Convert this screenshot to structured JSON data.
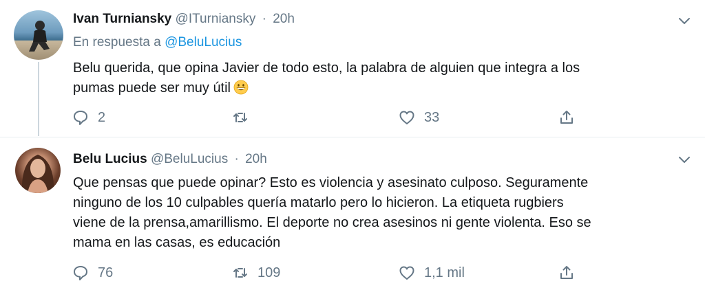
{
  "tweets": [
    {
      "name": "Ivan Turniansky",
      "handle": "@ITurniansky",
      "separator": "·",
      "time": "20h",
      "reply_prefix": "En respuesta a",
      "reply_mention": "@BeluLucius",
      "text": "Belu querida, que opina Javier de todo esto, la palabra de alguien  que integra a los\npumas puede ser muy útil",
      "emoji": "grinning-face-emoji",
      "replies": "2",
      "retweets": "",
      "likes": "33"
    },
    {
      "name": "Belu Lucius",
      "handle": "@BeluLucius",
      "separator": "·",
      "time": "20h",
      "text": "Que pensas que puede opinar? Esto es violencia y asesinato culposo. Seguramente\nninguno de los 10 culpables quería matarlo pero lo hicieron. La etiqueta rugbiers\nviene de la prensa,amarillismo. El deporte no crea asesinos ni gente violenta. Eso se\nmama en las casas, es educación",
      "replies": "76",
      "retweets": "109",
      "likes": "1,1 mil"
    }
  ],
  "icons": {
    "reply": "speech-bubble-icon",
    "retweet": "retweet-arrows-icon",
    "like": "heart-icon",
    "share": "share-upload-icon",
    "menu": "chevron-down-icon"
  },
  "colors": {
    "text": "#14171a",
    "secondary": "#657786",
    "link": "#1b95e0",
    "thread_line": "#ccd6dd",
    "divider": "#e6ecf0"
  }
}
